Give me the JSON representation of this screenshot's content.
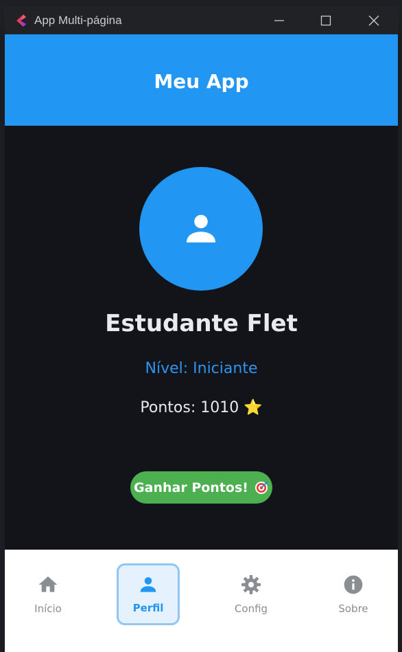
{
  "window": {
    "title": "App Multi-página"
  },
  "appbar": {
    "title": "Meu App",
    "color": "#2196f3"
  },
  "profile": {
    "name": "Estudante Flet",
    "level": "Nível: Iniciante",
    "points": "Pontos: 1010 ⭐",
    "avatar_icon": "person-icon"
  },
  "actions": {
    "earn_label": "Ganhar Pontos!",
    "earn_icon": "target-icon",
    "earn_color": "#4caf50"
  },
  "nav": {
    "selected": "Perfil",
    "items": [
      {
        "label": "Início",
        "icon": "home-icon"
      },
      {
        "label": "Perfil",
        "icon": "person-icon"
      },
      {
        "label": "Config",
        "icon": "gear-icon"
      },
      {
        "label": "Sobre",
        "icon": "info-icon"
      }
    ]
  }
}
